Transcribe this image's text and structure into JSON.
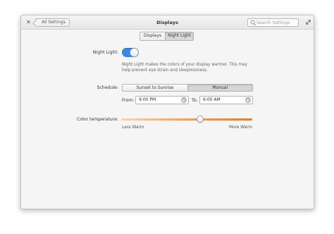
{
  "window": {
    "title": "Displays",
    "back_label": "All Settings",
    "close_glyph": "✕",
    "search_placeholder": "Search Settings"
  },
  "tabs": [
    {
      "label": "Displays",
      "active": false
    },
    {
      "label": "Night Light",
      "active": true
    }
  ],
  "night_light": {
    "label": "Night Light:",
    "enabled": true,
    "description": "Night Light makes the colors of your display warmer. This may help prevent eye strain and sleeplessness."
  },
  "schedule": {
    "label": "Schedule:",
    "options": [
      "Sunset to Sunrise",
      "Manual"
    ],
    "selected": "Manual",
    "from_label": "From:",
    "from_value": "9:00 PM",
    "to_label": "To:",
    "to_value": "6:00 AM"
  },
  "color_temperature": {
    "label": "Color temperature:",
    "min_label": "Less Warm",
    "max_label": "More Warm",
    "value_fraction": 0.6
  },
  "colors": {
    "accent": "#3689e6",
    "slider_warm": "#d7803d",
    "slider_cool": "#f5d4b0"
  },
  "icons": [
    "close-icon",
    "back-arrow",
    "search-icon",
    "maximize-icon",
    "clock-icon"
  ]
}
